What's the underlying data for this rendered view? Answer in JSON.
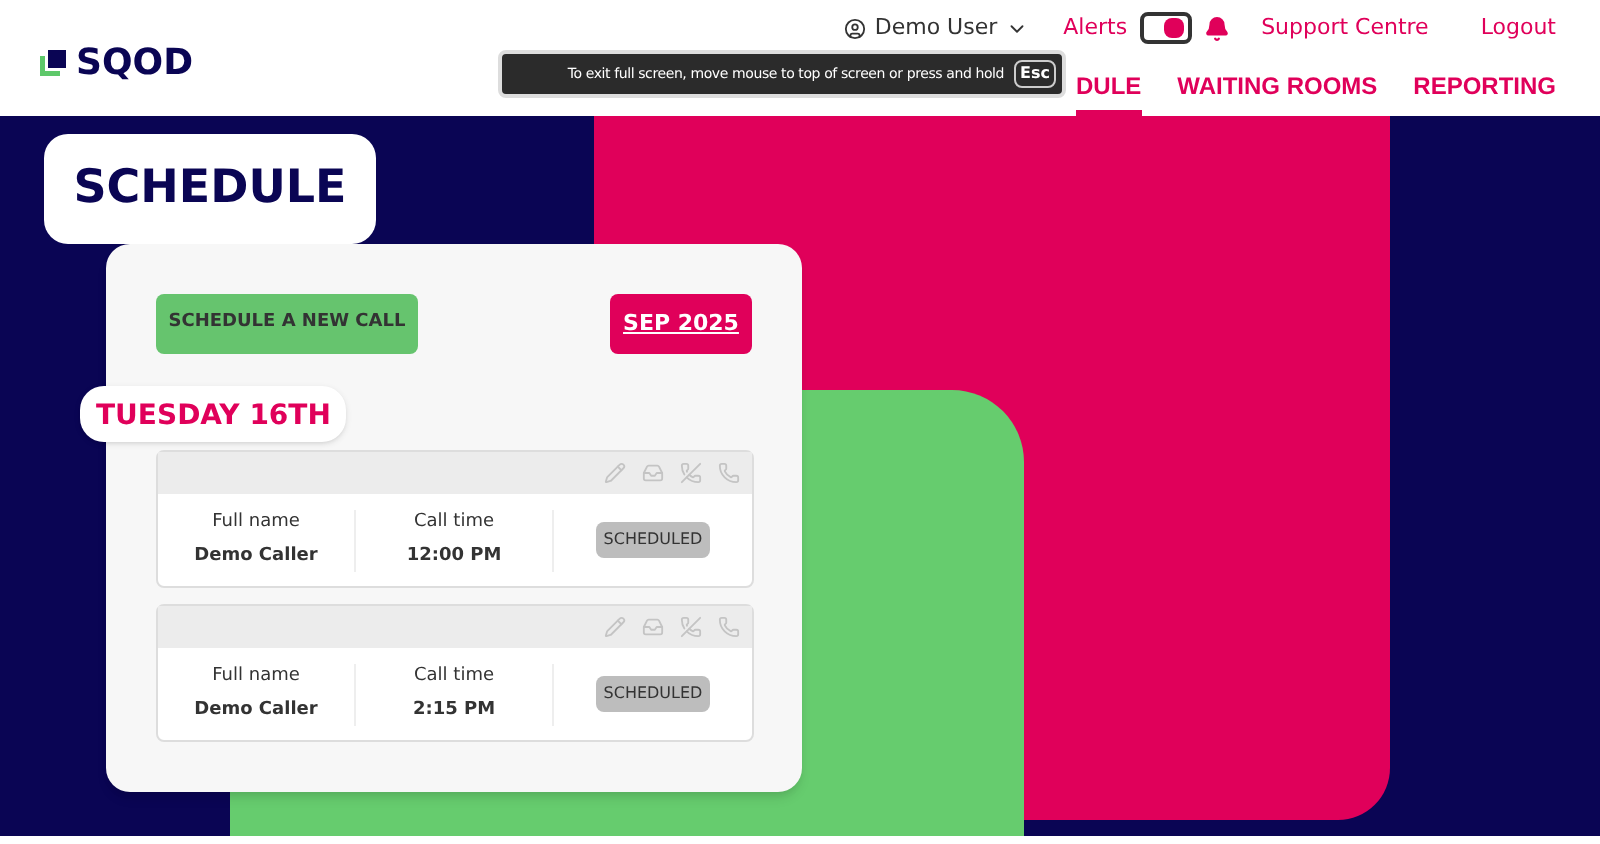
{
  "header": {
    "logo": "SQOD",
    "user": "Demo User",
    "alerts": {
      "label": "Alerts",
      "on": true
    },
    "links": [
      "Support Centre",
      "Logout"
    ],
    "nav": [
      {
        "label": "DULE",
        "selected": true
      },
      {
        "label": "WAITING ROOMS",
        "selected": false
      },
      {
        "label": "REPORTING",
        "selected": false
      }
    ]
  },
  "toast": {
    "text": "To exit full screen, move mouse to top of screen or press and hold",
    "key": "Esc"
  },
  "page_title": "SCHEDULE",
  "new_call_button": "SCHEDULE A NEW CALL",
  "month_button": "SEP 2025",
  "day": "TUESDAY 16TH",
  "calls": [
    {
      "name_label": "Full name",
      "name": "Demo Caller",
      "time_label": "Call time",
      "time": "12:00 PM",
      "status": "SCHEDULED"
    },
    {
      "name_label": "Full name",
      "name": "Demo Caller",
      "time_label": "Call time",
      "time": "2:15 PM",
      "status": "SCHEDULED"
    }
  ]
}
